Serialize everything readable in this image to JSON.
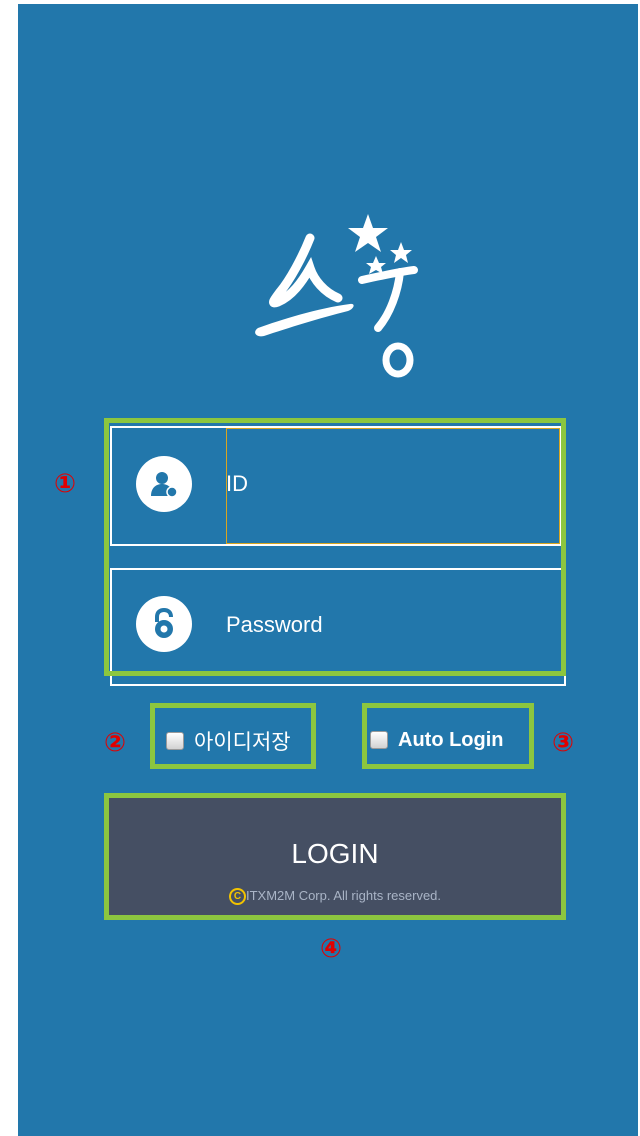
{
  "logo": {
    "name": "sgang-logo",
    "stars": 3
  },
  "form": {
    "id_placeholder": "ID",
    "password_placeholder": "Password"
  },
  "options": {
    "save_id_label": "아이디저장",
    "auto_login_label": "Auto Login"
  },
  "login": {
    "button_label": "LOGIN",
    "copyright_symbol": "C",
    "copyright_text": "ITXM2M Corp. All rights reserved."
  },
  "annotations": {
    "one": "①",
    "two": "②",
    "three": "③",
    "four": "④"
  },
  "colors": {
    "background": "#2277ab",
    "annotation_box": "#8cc63f",
    "annotation_number": "#e10000",
    "login_button": "#454f63"
  },
  "icons": [
    "user-icon",
    "lock-icon",
    "checkbox-icon"
  ]
}
